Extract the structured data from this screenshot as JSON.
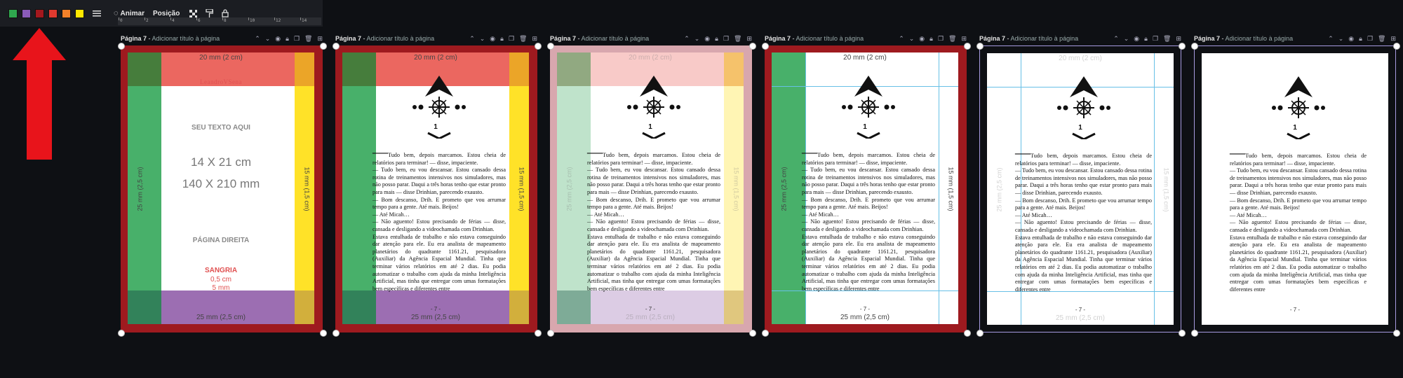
{
  "toolbar": {
    "swatches": [
      {
        "name": "green-swatch",
        "color": "#2fa84f"
      },
      {
        "name": "purple-swatch",
        "color": "#8a5bb8"
      },
      {
        "name": "dark-red-swatch",
        "color": "#a3181e"
      },
      {
        "name": "red-swatch",
        "color": "#e03a2f"
      },
      {
        "name": "orange-swatch",
        "color": "#f2812a"
      },
      {
        "name": "yellow-swatch",
        "color": "#ffe800"
      }
    ],
    "animate_label": "Animar",
    "position_label": "Posição"
  },
  "ruler": {
    "ticks": [
      "0",
      "2",
      "4",
      "6",
      "8",
      "10",
      "12",
      "14"
    ]
  },
  "arrow_color": "#e8141b",
  "page_title": "Página 7",
  "page_title_sep": " - ",
  "page_subtitle": "Adicionar título à página",
  "margins": {
    "top": "20 mm (2 cm)",
    "bottom": "25 mm (2,5 cm)",
    "left": "25 mm (2,5 cm)",
    "right": "15 mm (1,5 cm)"
  },
  "template": {
    "brand": "LeandroVSena",
    "your_text": "SEU TEXTO AQUI",
    "size_cm": "14 X 21 cm",
    "size_mm": "140 X 210 mm",
    "page_side": "PÁGINA DIREITA",
    "bleed_label": "SANGRIA",
    "bleed_cm": "0,5 cm",
    "bleed_mm": "5 mm"
  },
  "body_text": "—Tudo bem, depois marcamos. Estou cheia de relatórios para terminar! — disse, impaciente.\n— Tudo bem, eu vou descansar. Estou cansado dessa rotina de treinamentos intensivos nos simuladores, mas não posso parar. Daqui a três horas tenho que estar pronto para mais — disse Drinhian, parecendo exausto.\n— Bom descanso, Drih. E prometo que vou arrumar tempo para a gente. Até mais. Beijos!\n— Até Micah…\n— Não aguento! Estou precisando de férias — disse, cansada e desligando a videochamada com Drinhian.\nEstava entulhada de trabalho e não estava conseguindo dar atenção para ele. Eu era analista de mapeamento planetários do quadrante 1161.21, pesquisadora (Auxiliar) da Agência Espacial Mundial. Tinha que terminar vários relatórios em até 2 dias. Eu podia automatizar o trabalho com ajuda da minha Inteligência Artificial, mas tinha que entregar com umas formatações bem específicas e diferentes entre",
  "chapter_number": "1",
  "page_number": "- 7 -"
}
